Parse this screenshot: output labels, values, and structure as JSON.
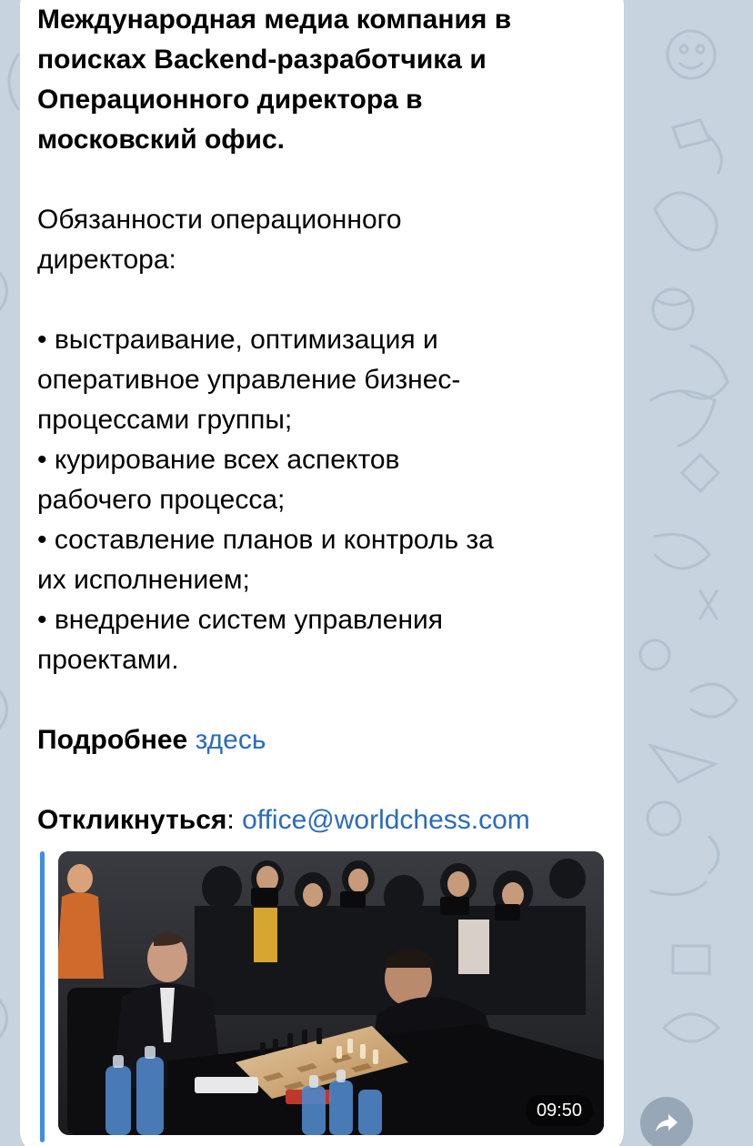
{
  "message": {
    "title_lines": [
      "Международная медиа компания в",
      "поисках Backend-разработчика и",
      "Операционного директора в",
      "московский офис."
    ],
    "duties_heading_lines": [
      "Обязанности операционного",
      "директора:"
    ],
    "duties_lines": [
      "• выстраивание, оптимизация и",
      "оперативное управление бизнес-",
      "процессами группы;",
      "• курирование всех аспектов",
      "рабочего процесса;",
      "• составление планов и контроль за",
      "их исполнением;",
      "• внедрение систем управления",
      "проектами."
    ],
    "more_label": "Подробнее",
    "more_link": "здесь",
    "respond_label": "Откликнуться",
    "respond_colon": ":",
    "respond_email": "office@worldchess.com"
  },
  "preview": {
    "duration": "09:50"
  },
  "icons": {
    "share": "share-arrow-icon",
    "link_bar_color": "#3d8fe3",
    "link_color": "#2a6bbf",
    "wallpaper_color": "#c7d3de"
  }
}
